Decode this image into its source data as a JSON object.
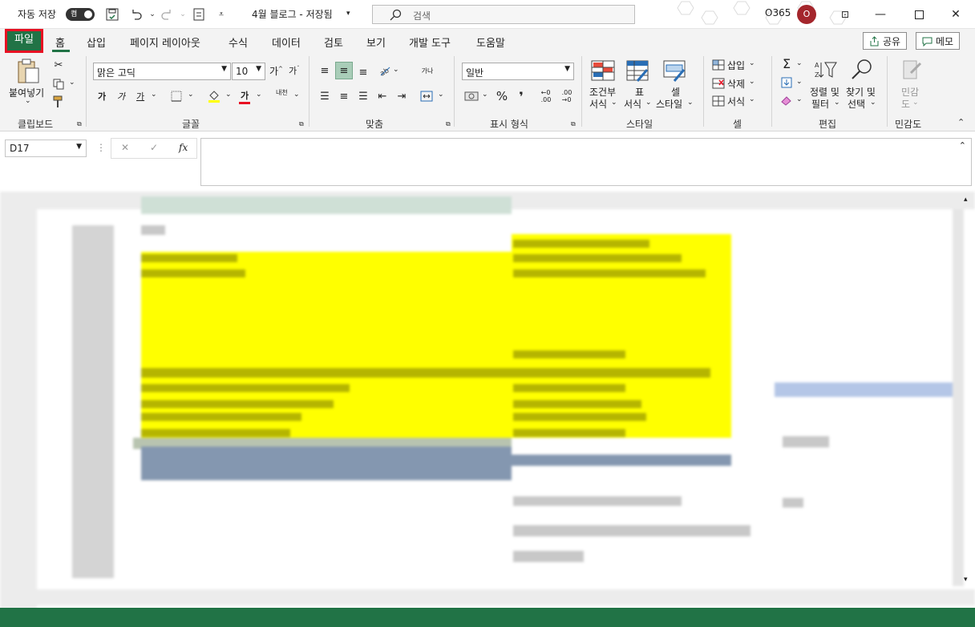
{
  "titlebar": {
    "autosave_label": "자동 저장",
    "autosave_state": "켬",
    "doc_title": "4월 블로그 - 저장됨",
    "search_placeholder": "검색",
    "account": "O365",
    "avatar_initial": "O"
  },
  "tabs": {
    "file": "파일",
    "items": [
      "홈",
      "삽입",
      "페이지 레이아웃",
      "수식",
      "데이터",
      "검토",
      "보기",
      "개발 도구",
      "도움말"
    ],
    "share": "공유",
    "comments": "메모"
  },
  "ribbon": {
    "clipboard": {
      "paste": "붙여넣기",
      "label": "클립보드"
    },
    "font": {
      "name": "맑은 고딕",
      "size": "10",
      "bold": "가",
      "italic": "가",
      "underline": "가",
      "grow": "가",
      "shrink": "가",
      "phonetic": "내천",
      "label": "글꼴"
    },
    "alignment": {
      "wrap": "가나",
      "label": "맞춤"
    },
    "number": {
      "format": "일반",
      "label": "표시 형식"
    },
    "styles": {
      "cond1": "조건부",
      "cond2": "서식",
      "table1": "표",
      "table2": "서식",
      "cell1": "셀",
      "cell2": "스타일",
      "label": "스타일"
    },
    "cells": {
      "insert": "삽입",
      "delete": "삭제",
      "format": "서식",
      "label": "셀"
    },
    "editing": {
      "sort1": "정렬 및",
      "sort2": "필터",
      "find1": "찾기 및",
      "find2": "선택",
      "label": "편집"
    },
    "sensitivity": {
      "l1": "민감",
      "l2": "도",
      "label": "민감도"
    }
  },
  "formula_bar": {
    "cell_ref": "D17",
    "fx": "fx"
  },
  "colors": {
    "excel_green": "#217346",
    "highlight": "#ffff00",
    "selection": "#8497b0"
  }
}
